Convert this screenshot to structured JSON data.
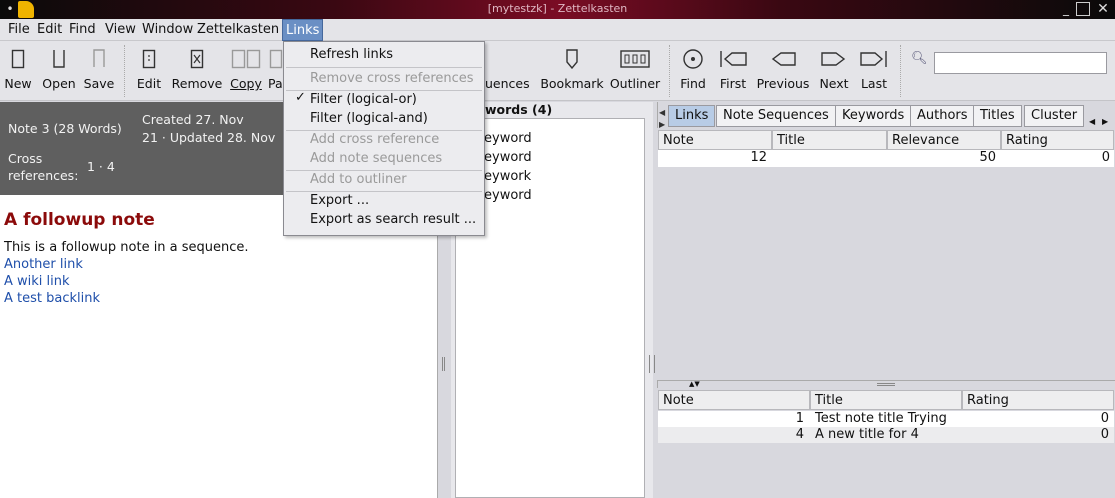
{
  "window": {
    "title": "[mytestzk] - Zettelkasten"
  },
  "menubar": {
    "items": [
      "File",
      "Edit",
      "Find",
      "View",
      "Window",
      "Zettelkasten",
      "Links"
    ]
  },
  "toolbar": {
    "new": "New",
    "open": "Open",
    "save": "Save",
    "edit": "Edit",
    "remove": "Remove",
    "copy": "Copy",
    "paste": "Pa",
    "sequences": "uences",
    "bookmark": "Bookmark",
    "outliner": "Outliner",
    "find": "Find",
    "first": "First",
    "previous": "Previous",
    "next": "Next",
    "last": "Last"
  },
  "links_menu": {
    "items": [
      {
        "label": "Refresh links",
        "enabled": true
      },
      {
        "label": "Remove cross references",
        "enabled": false
      },
      {
        "label": "Filter (logical-or)",
        "enabled": true,
        "checked": true
      },
      {
        "label": "Filter (logical-and)",
        "enabled": true
      },
      {
        "label": "Add cross reference",
        "enabled": false
      },
      {
        "label": "Add note sequences",
        "enabled": false
      },
      {
        "label": "Add to outliner",
        "enabled": false
      },
      {
        "label": "Export ...",
        "enabled": true
      },
      {
        "label": "Export as search result ...",
        "enabled": true
      }
    ]
  },
  "note_info": {
    "note": "Note 3 (28 Words)",
    "created": "Created 27. Nov",
    "updated": "21 · Updated 28. Nov",
    "crossref_label_1": "Cross",
    "crossref_label_2": "references:",
    "crossref_values": "1 · 4"
  },
  "note": {
    "title": "A followup note",
    "body": "This is a followup note in a sequence.",
    "links": [
      "Another link",
      "A wiki link",
      "A test backlink"
    ]
  },
  "keywords": {
    "header": "words (4)",
    "items": [
      "eyword",
      "eyword",
      "eywork",
      "eyword"
    ]
  },
  "tabs": [
    "Links",
    "Note Sequences",
    "Keywords",
    "Authors",
    "Titles",
    "Cluster"
  ],
  "links_table": {
    "headers": [
      "Note",
      "Title",
      "Relevance",
      "Rating"
    ],
    "rows": [
      {
        "note": "12",
        "title": "",
        "relevance": "50",
        "rating": "0"
      }
    ]
  },
  "links_table2": {
    "headers": [
      "Note",
      "Title",
      "Rating"
    ],
    "rows": [
      {
        "note": "1",
        "title": "Test note title Trying",
        "rating": "0"
      },
      {
        "note": "4",
        "title": "A new title for 4",
        "rating": "0"
      }
    ]
  }
}
